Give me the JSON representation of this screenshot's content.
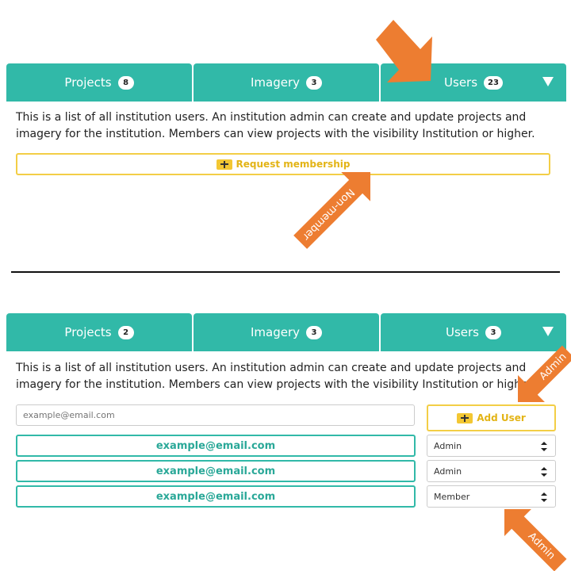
{
  "top_panel": {
    "tabs": [
      {
        "label": "Projects",
        "count": "8"
      },
      {
        "label": "Imagery",
        "count": "3"
      },
      {
        "label": "Users",
        "count": "23"
      }
    ],
    "description": "This is a list of all institution users. An institution admin can create and update projects and imagery for the institution. Members can view projects with the visibility Institution or higher.",
    "request_button_label": "Request membership"
  },
  "bottom_panel": {
    "tabs": [
      {
        "label": "Projects",
        "count": "2"
      },
      {
        "label": "Imagery",
        "count": "3"
      },
      {
        "label": "Users",
        "count": "3"
      }
    ],
    "description": "This is a list of all institution users. An institution admin can create and update projects and imagery for the institution. Members can view projects with the visibility Institution or higher.",
    "email_input": {
      "value": "",
      "placeholder": "example@email.com"
    },
    "add_user_label": "Add User",
    "users": [
      {
        "email": "example@email.com",
        "role": "Admin"
      },
      {
        "email": "example@email.com",
        "role": "Admin"
      },
      {
        "email": "example@email.com",
        "role": "Member"
      }
    ]
  },
  "annotations": {
    "non_member_label": "Non-member",
    "admin_label_top": "Admin",
    "admin_label_bottom": "Admin",
    "arrow_color": "#ed7d31"
  },
  "colors": {
    "teal": "#31b9a8",
    "yellow": "#f3ce46"
  }
}
